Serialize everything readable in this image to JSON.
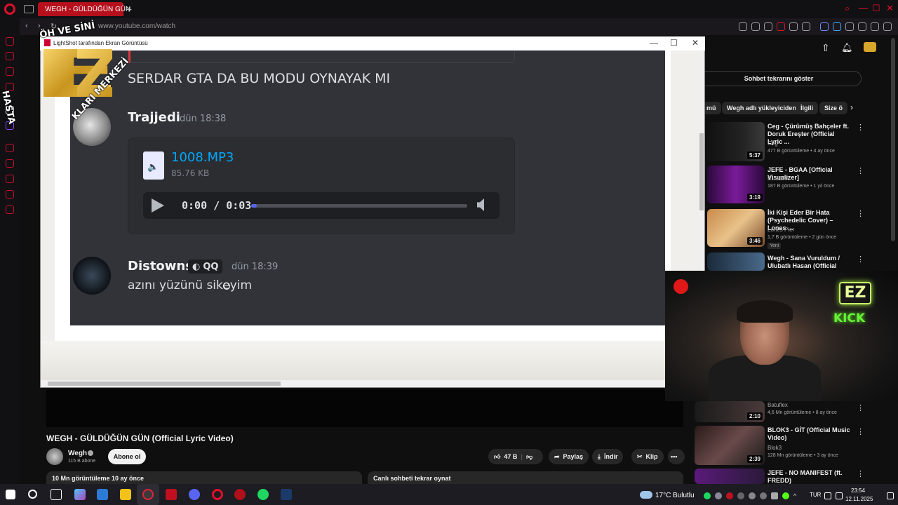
{
  "browser": {
    "tab_title": "WEGH - GÜLDÜĞÜN GÜN",
    "new_tab": "+",
    "url": "www.youtube.com/watch"
  },
  "youtube": {
    "chat_replay_button": "Sohbet tekrarını göster",
    "chips": [
      "mü",
      "Wegh adlı yükleyiciden",
      "İlgili",
      "Size ö"
    ],
    "related": [
      {
        "title": "Ceg - Çürümüş Bahçeler ft. Doruk Ereşter (Official Lyric ...",
        "channel": "Ceg",
        "meta": "477 B görüntüleme • 4 ay önce",
        "duration": "5:37",
        "badge": ""
      },
      {
        "title": "JEFE - BGAA [Official Visualizer]",
        "channel": "EL JEFE",
        "meta": "187 B görüntüleme • 1 yıl önce",
        "duration": "3:19",
        "badge": ""
      },
      {
        "title": "İki Kişi Eder Bir Hata (Psychedelic Cover) – Lones ...",
        "channel": "Lones Pier",
        "meta": "1,7 B görüntüleme • 2 gün önce",
        "duration": "3:46",
        "badge": "Yeni"
      },
      {
        "title": "Wegh - Sana Vuruldum / Ulubatlı Hasan (Official Music ...",
        "channel": "",
        "meta": "",
        "duration": "",
        "badge": ""
      },
      {
        "title": "",
        "channel": "Batuflex",
        "meta": "4,6 Mn görüntüleme • 8 ay önce",
        "duration": "2:10",
        "badge": ""
      },
      {
        "title": "BLOK3 - GİT (Official Music Video)",
        "channel": "Blok3",
        "meta": "128 Mn görüntüleme • 3 ay önce",
        "duration": "2:39",
        "badge": ""
      },
      {
        "title": "JEFE - NO MANIFEST (ft. FREDD)",
        "channel": "",
        "meta": "",
        "duration": "",
        "badge": ""
      }
    ],
    "video_title": "WEGH - GÜLDÜĞÜN GÜN (Official Lyric Video)",
    "channel_name": "Wegh",
    "channel_subs": "115 B abone",
    "subscribe": "Abone ol",
    "likes": "47 B",
    "share": "Paylaş",
    "download": "İndir",
    "clip": "Klip",
    "more": "•••",
    "desc_meta": "10 Mn görüntüleme  10 ay önce",
    "chat_replay_header": "Canlı sohbeti tekrar oynat"
  },
  "lightshot": {
    "title": "LightShot tarafından Ekran Görüntüsü",
    "discord": {
      "message_top": "SERDAR GTA DA BU MODU OYNAYAK MI",
      "user1": "Trajjedi",
      "time1": "dün 18:38",
      "file_name": "1008.MP3",
      "file_size": "85.76 KB",
      "player_time": "0:00 / 0:03",
      "user2": "Distowns",
      "badge": "QQ",
      "time2": "dün 18:39",
      "message2": "azını yüzünü sikeyim"
    }
  },
  "overlay": {
    "ring_top": "ÖH VE SİNİ",
    "ring_left": "HASTA",
    "ring_mid": "KLARI MERKEZİ",
    "neon_ez": "EZ",
    "neon_kick": "KICK"
  },
  "taskbar": {
    "temp": "17°C",
    "weather": "Bulutlu",
    "lang": "TUR",
    "time": "23:54",
    "date": "12.11.2025"
  }
}
